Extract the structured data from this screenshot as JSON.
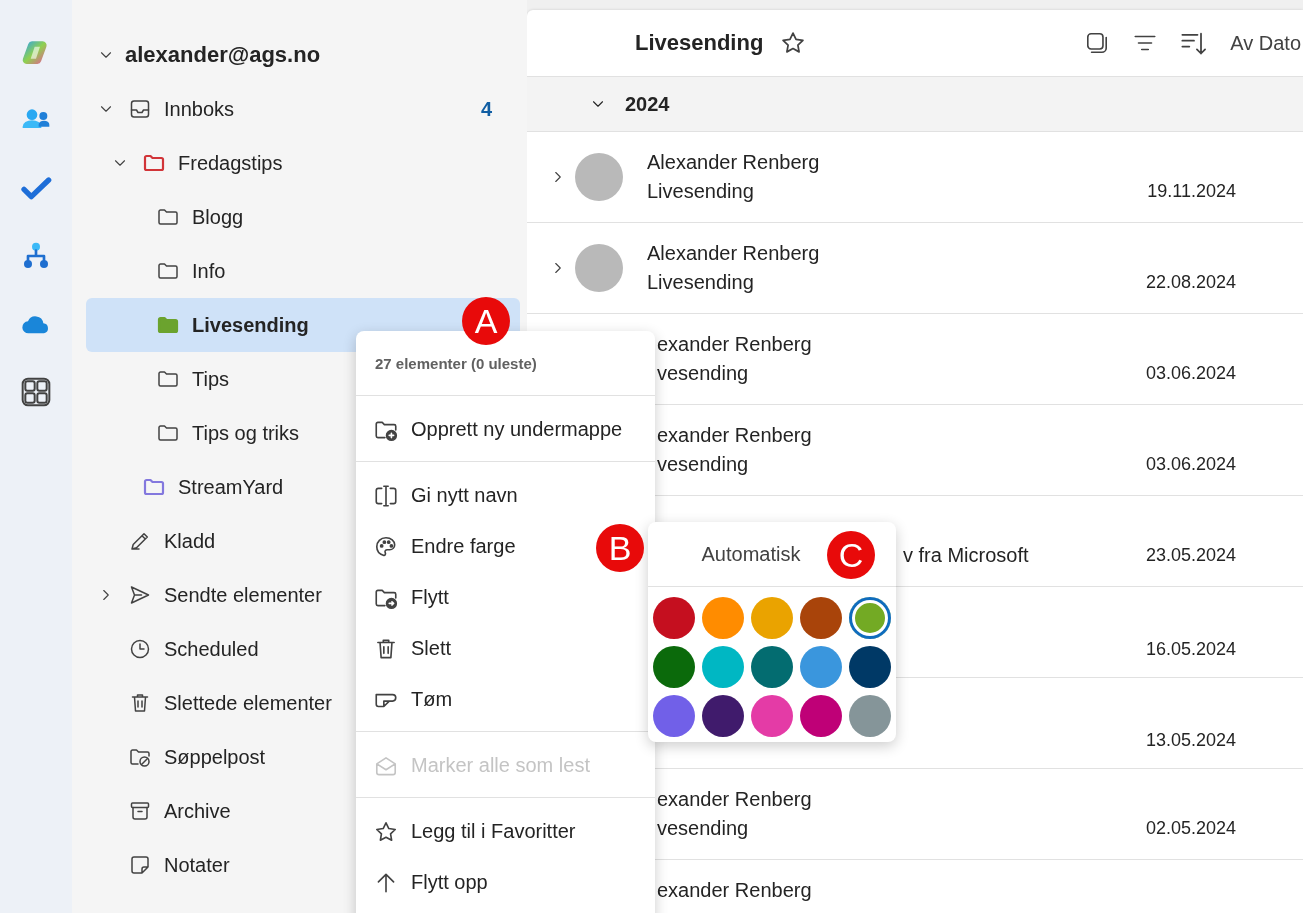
{
  "folders": {
    "account": {
      "label": "alexander@ags.no",
      "expanded": true,
      "children": [
        {
          "label": "Innboks",
          "kind": "inbox",
          "expanded": true,
          "selected": false,
          "count": "4",
          "children": [
            {
              "label": "Fredagstips",
              "kind": "folder",
              "expanded": true,
              "selected": false,
              "color": "#d13438",
              "children": [
                {
                  "label": "Blogg",
                  "kind": "folder",
                  "selected": false
                },
                {
                  "label": "Info",
                  "kind": "folder",
                  "selected": false
                },
                {
                  "label": "Livesending",
                  "kind": "folder",
                  "selected": true,
                  "color": "#6ba32e"
                },
                {
                  "label": "Tips",
                  "kind": "folder",
                  "selected": false
                },
                {
                  "label": "Tips og triks",
                  "kind": "folder",
                  "selected": false
                }
              ]
            },
            {
              "label": "StreamYard",
              "kind": "folder",
              "selected": false,
              "color": "#8378de"
            }
          ]
        },
        {
          "label": "Kladd",
          "kind": "drafts",
          "selected": false
        },
        {
          "label": "Sendte elementer",
          "kind": "sent",
          "expanded": false,
          "selected": false
        },
        {
          "label": "Scheduled",
          "kind": "clock",
          "selected": false
        },
        {
          "label": "Slettede elementer",
          "kind": "trash",
          "selected": false
        },
        {
          "label": "Søppelpost",
          "kind": "junk",
          "selected": false
        },
        {
          "label": "Archive",
          "kind": "archive",
          "selected": false
        },
        {
          "label": "Notater",
          "kind": "note",
          "selected": false
        }
      ]
    }
  },
  "message_list": {
    "title": "Livesending",
    "favorite": false,
    "sort_label": "Av Dato",
    "group": {
      "label": "2024",
      "expanded": true
    },
    "rows": [
      {
        "kind": "full",
        "expanded": false,
        "sender": "Alexander Renberg",
        "subject": "Livesending",
        "date": "19.11.2024"
      },
      {
        "kind": "full",
        "expanded": false,
        "sender": "Alexander Renberg",
        "subject": "Livesending",
        "date": "22.08.2024"
      },
      {
        "kind": "behind-menu",
        "sender": "exander Renberg",
        "subject": "vesending",
        "date": "03.06.2024"
      },
      {
        "kind": "behind-menu",
        "sender": "exander Renberg",
        "subject": "vesending",
        "date": "03.06.2024"
      },
      {
        "kind": "behind-picker",
        "subject": "v fra Microsoft",
        "date": "23.05.2024"
      },
      {
        "kind": "behind-picker",
        "date": "16.05.2024"
      },
      {
        "kind": "behind-picker",
        "date": "13.05.2024"
      },
      {
        "kind": "behind-menu",
        "sender": "exander Renberg",
        "subject": "vesending",
        "date": "02.05.2024"
      },
      {
        "kind": "behind-menu",
        "sender": "exander Renberg"
      }
    ]
  },
  "context_menu": {
    "summary": "27 elementer (0 uleste)",
    "groups": [
      [
        {
          "label": "Opprett ny undermappe",
          "kind": "folder-add",
          "disabled": false
        }
      ],
      [
        {
          "label": "Gi nytt navn",
          "kind": "rename",
          "disabled": false
        },
        {
          "label": "Endre farge",
          "kind": "palette",
          "disabled": false
        },
        {
          "label": "Flytt",
          "kind": "folder-move",
          "disabled": false
        },
        {
          "label": "Slett",
          "kind": "trash",
          "disabled": false
        },
        {
          "label": "Tøm",
          "kind": "eraser",
          "disabled": false
        }
      ],
      [
        {
          "label": "Marker alle som lest",
          "kind": "mail-open",
          "disabled": true
        }
      ],
      [
        {
          "label": "Legg til i Favoritter",
          "kind": "star",
          "disabled": false
        },
        {
          "label": "Flytt opp",
          "kind": "arrow-up",
          "disabled": false
        }
      ]
    ]
  },
  "color_picker": {
    "automatic": "Automatisk",
    "swatches": [
      {
        "color": "#c50f1f",
        "selected": false
      },
      {
        "color": "#ff8c00",
        "selected": false
      },
      {
        "color": "#eaa300",
        "selected": false
      },
      {
        "color": "#a9440a",
        "selected": false
      },
      {
        "color": "#73aa24",
        "selected": true
      },
      {
        "color": "#0b6a0b",
        "selected": false
      },
      {
        "color": "#00b7c3",
        "selected": false
      },
      {
        "color": "#036c70",
        "selected": false
      },
      {
        "color": "#3a96dd",
        "selected": false
      },
      {
        "color": "#003966",
        "selected": false
      },
      {
        "color": "#7160e8",
        "selected": false
      },
      {
        "color": "#401b6c",
        "selected": false
      },
      {
        "color": "#e43ba6",
        "selected": false
      },
      {
        "color": "#bf0077",
        "selected": false
      },
      {
        "color": "#859599",
        "selected": false
      }
    ]
  },
  "markers": [
    {
      "label": "A"
    },
    {
      "label": "B"
    },
    {
      "label": "C"
    }
  ]
}
